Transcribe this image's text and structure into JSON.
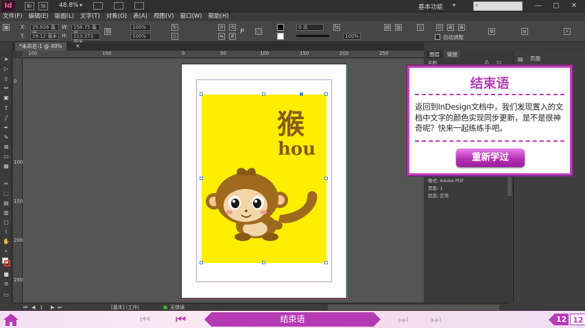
{
  "titlebar": {
    "app_icon": "Id",
    "box1": "Br",
    "box2": "St",
    "zoom": "48.8%",
    "workspace": "基本功能",
    "minimize": "—",
    "maximize": "□",
    "close": "✕"
  },
  "menu": [
    "文件(F)",
    "编辑(E)",
    "版面(L)",
    "文字(T)",
    "对象(O)",
    "表(A)",
    "视图(V)",
    "窗口(W)",
    "帮助(H)"
  ],
  "control": {
    "x_label": "X:",
    "y_label": "Y:",
    "w_label": "W:",
    "h_label": "H:",
    "x_value": "25.826 毫米",
    "y_value": "19.12 毫米",
    "w_value": "158.75 毫米",
    "h_value": "213.373 毫米",
    "scale_x": "100%",
    "scale_y": "100%",
    "stroke_weight": "0 点",
    "opacity": "100%",
    "auto_fit": "自动调整",
    "p_label": "P"
  },
  "document": {
    "tab_label": "*未命名-1 @ 49%"
  },
  "ruler_h": [
    "100",
    "150",
    "0",
    "50",
    "100",
    "150",
    "200",
    "250"
  ],
  "ruler_v": [
    "0",
    "100",
    "150",
    "200",
    "250"
  ],
  "artwork": {
    "hanzi": "猴",
    "pinyin": "hou"
  },
  "panels": {
    "tab1": "图层",
    "tab2": "链接",
    "pages_tab": "页面",
    "name_label": "名称",
    "info": [
      "格式: Adobe PDF",
      "页面: 1",
      "状态: 正常"
    ]
  },
  "statusbar": {
    "page": "1",
    "preset": "[基本] (工作)",
    "errors": "无错误"
  },
  "popup": {
    "title": "结束语",
    "body": "返回到InDesign文档中，我们发现置入的文档中文字的颜色实现同步更新，是不是很神奇呢？快来一起练练手吧。",
    "button": "重新学过"
  },
  "bottomnav": {
    "chapter": "结束语",
    "current_page": "12",
    "total_pages": "12"
  },
  "colors": {
    "accent": "#b53bb5",
    "yellow": "#ffee00",
    "brown": "#8a5a15"
  }
}
